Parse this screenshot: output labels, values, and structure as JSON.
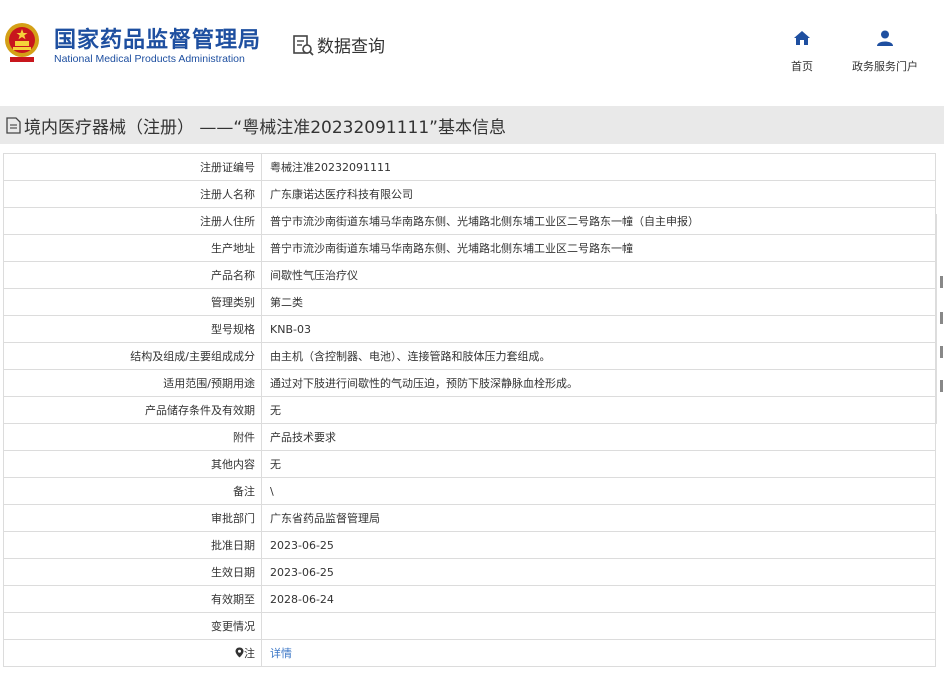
{
  "header": {
    "brand_cn": "国家药品监督管理局",
    "brand_en": "National Medical Products Administration",
    "query_label": "数据查询",
    "nav": [
      {
        "label": "首页",
        "icon": "home-icon"
      },
      {
        "label": "政务服务门户",
        "icon": "user-icon"
      }
    ],
    "accent_color": "#1e4fa0"
  },
  "page_title": "境内医疗器械（注册）  ——“粤械注准20232091111”基本信息",
  "rows": [
    {
      "label": "注册证编号",
      "value": "粤械注准20232091111"
    },
    {
      "label": "注册人名称",
      "value": "广东康诺达医疗科技有限公司"
    },
    {
      "label": "注册人住所",
      "value": "普宁市流沙南街道东埔马华南路东侧、光埔路北侧东埔工业区二号路东一幢（自主申报）"
    },
    {
      "label": "生产地址",
      "value": "普宁市流沙南街道东埔马华南路东侧、光埔路北侧东埔工业区二号路东一幢"
    },
    {
      "label": "产品名称",
      "value": "间歇性气压治疗仪"
    },
    {
      "label": "管理类别",
      "value": "第二类"
    },
    {
      "label": "型号规格",
      "value": "KNB-03"
    },
    {
      "label": "结构及组成/主要组成成分",
      "value": "由主机（含控制器、电池）、连接管路和肢体压力套组成。"
    },
    {
      "label": "适用范围/预期用途",
      "value": "通过对下肢进行间歇性的气动压迫，预防下肢深静脉血栓形成。"
    },
    {
      "label": "产品储存条件及有效期",
      "value": "无"
    },
    {
      "label": "附件",
      "value": "产品技术要求"
    },
    {
      "label": "其他内容",
      "value": "无"
    },
    {
      "label": "备注",
      "value": "\\"
    },
    {
      "label": "审批部门",
      "value": "广东省药品监督管理局"
    },
    {
      "label": "批准日期",
      "value": "2023-06-25"
    },
    {
      "label": "生效日期",
      "value": "2023-06-25"
    },
    {
      "label": "有效期至",
      "value": "2028-06-24"
    },
    {
      "label": "变更情况",
      "value": ""
    },
    {
      "label": "注",
      "value": "详情",
      "label_icon": "pin-icon",
      "link": true
    }
  ]
}
